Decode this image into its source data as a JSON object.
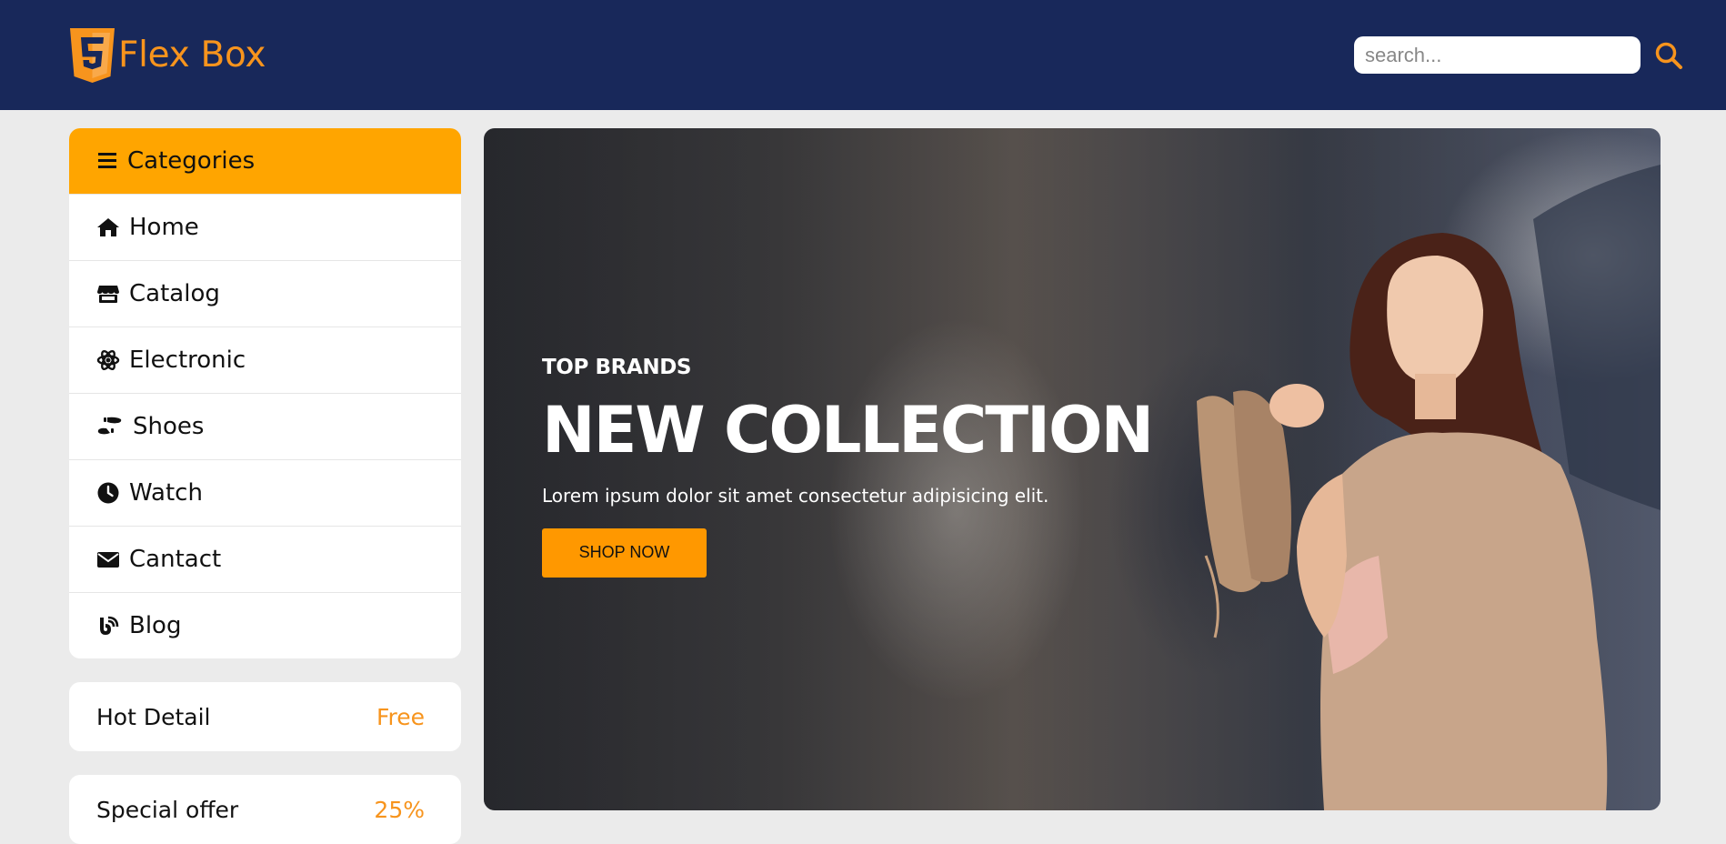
{
  "header": {
    "brand_name": "Flex Box",
    "logo_icon": "html5-shield-logo",
    "search": {
      "placeholder": "search...",
      "value": "",
      "icon": "search-icon"
    }
  },
  "sidebar": {
    "categories_title": "Categories",
    "items": [
      {
        "label": "Home",
        "icon": "home-icon"
      },
      {
        "label": "Catalog",
        "icon": "store-icon"
      },
      {
        "label": "Electronic",
        "icon": "atom-icon"
      },
      {
        "label": "Shoes",
        "icon": "shoe-prints-icon"
      },
      {
        "label": "Watch",
        "icon": "clock-icon"
      },
      {
        "label": "Cantact",
        "icon": "envelope-icon"
      },
      {
        "label": "Blog",
        "icon": "blog-icon"
      }
    ],
    "hot_detail": {
      "label": "Hot Detail",
      "value": "Free"
    },
    "special_offer": {
      "label": "Special offer",
      "value": "25%"
    }
  },
  "hero": {
    "eyebrow": "TOP BRANDS",
    "title": "NEW COLLECTION",
    "subtitle": "Lorem ipsum dolor sit amet consectetur adipisicing elit.",
    "cta_label": "SHOP NOW"
  },
  "colors": {
    "navbar": "#18285a",
    "accent": "#ffa500",
    "brand_orange": "#f7941d",
    "background": "#ebebeb"
  }
}
